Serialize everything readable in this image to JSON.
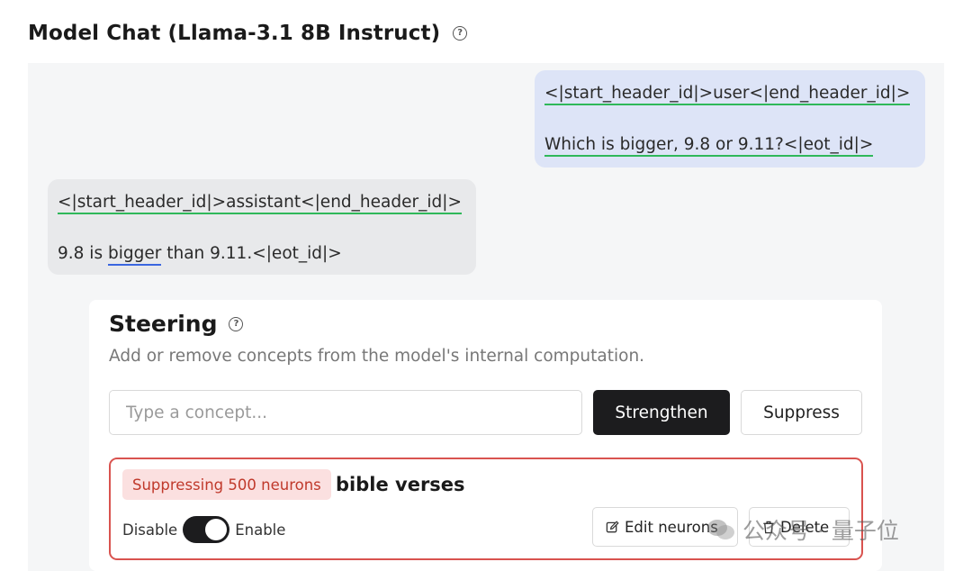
{
  "header": {
    "title": "Model Chat (Llama-3.1 8B Instruct)",
    "help_icon": "question-circle-icon"
  },
  "chat": {
    "user_message": {
      "line1": "<|start_header_id|>user<|end_header_id|>",
      "line2": "Which is bigger, 9.8 or 9.11?<|eot_id|>"
    },
    "assistant_message": {
      "line1": "<|start_header_id|>assistant<|end_header_id|>",
      "line2_before": "9.8 is ",
      "line2_highlight": "bigger",
      "line2_after": " than 9.11.<|eot_id|>"
    }
  },
  "steering": {
    "title": "Steering",
    "description": "Add or remove concepts from the model's internal computation.",
    "input_placeholder": "Type a concept...",
    "strengthen_label": "Strengthen",
    "suppress_label": "Suppress",
    "concept": {
      "badge": "Suppressing 500 neurons",
      "name": "bible verses",
      "disable_label": "Disable",
      "enable_label": "Enable",
      "enabled": true,
      "edit_label": "Edit neurons",
      "delete_label": "Delete"
    }
  },
  "watermark": {
    "text": "公众号 · 量子位"
  },
  "colors": {
    "user_bubble": "#dde4f7",
    "assistant_bubble": "#e8e9eb",
    "token_underline_green": "#2fb85a",
    "token_underline_blue": "#3a66e0",
    "primary_button": "#1c1c1e",
    "concept_border": "#d9534f",
    "badge_bg": "#fbe0e0",
    "badge_text": "#c0392b"
  }
}
